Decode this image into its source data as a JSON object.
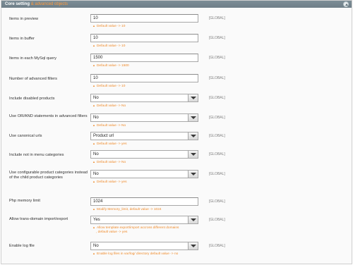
{
  "header": {
    "title": "Core setting",
    "subtitle": "& advanced objects"
  },
  "rows": [
    {
      "label": "Items in preview",
      "type": "input",
      "value": "10",
      "note": "Default value -> 10",
      "scope": "[GLOBAL]"
    },
    {
      "label": "Items in buffer",
      "type": "input",
      "value": "10",
      "note": "Default value -> 10",
      "scope": "[GLOBAL]"
    },
    {
      "label": "Items in each MySql query",
      "type": "input",
      "value": "1500",
      "note": "Default value -> 1500",
      "scope": "[GLOBAL]"
    },
    {
      "label": "Number of advanced filters",
      "type": "input",
      "value": "10",
      "note": "Default value -> 10",
      "scope": "[GLOBAL]"
    },
    {
      "label": "Include disabled products",
      "type": "select",
      "value": "No",
      "note": "Default value -> No",
      "scope": "[GLOBAL]"
    },
    {
      "label": "Use OR/AND statements in advanced filters",
      "type": "select",
      "value": "No",
      "note": "Default value -> No",
      "scope": "[GLOBAL]"
    },
    {
      "label": "Use canonical urls",
      "type": "select",
      "value": "Product url",
      "note": "Default value -> yes",
      "scope": "[GLOBAL]"
    },
    {
      "label": "Include not in menu categories",
      "type": "select",
      "value": "No",
      "note": "Default value -> No",
      "scope": "[GLOBAL]"
    },
    {
      "label": "Use configurable product categories instead of the child product categories",
      "type": "select",
      "value": "No",
      "note": "Default value -> yes",
      "scope": "[GLOBAL]"
    },
    {
      "label": "Php memory limit",
      "type": "input",
      "value": "1024",
      "note": "Modify Memory_limit, default value -> 1024",
      "scope": "[GLOBAL]"
    },
    {
      "label": "Allow trans-domain import/export",
      "type": "select",
      "value": "Yes",
      "note": "Allow template export/import accross different domains",
      "note2": ", default value -> yes",
      "scope": "[GLOBAL]"
    },
    {
      "label": "Enable log file",
      "type": "select",
      "value": "No",
      "note": "Enable log files in var/log/ directory default value -> no",
      "scope": "[GLOBAL]"
    }
  ]
}
